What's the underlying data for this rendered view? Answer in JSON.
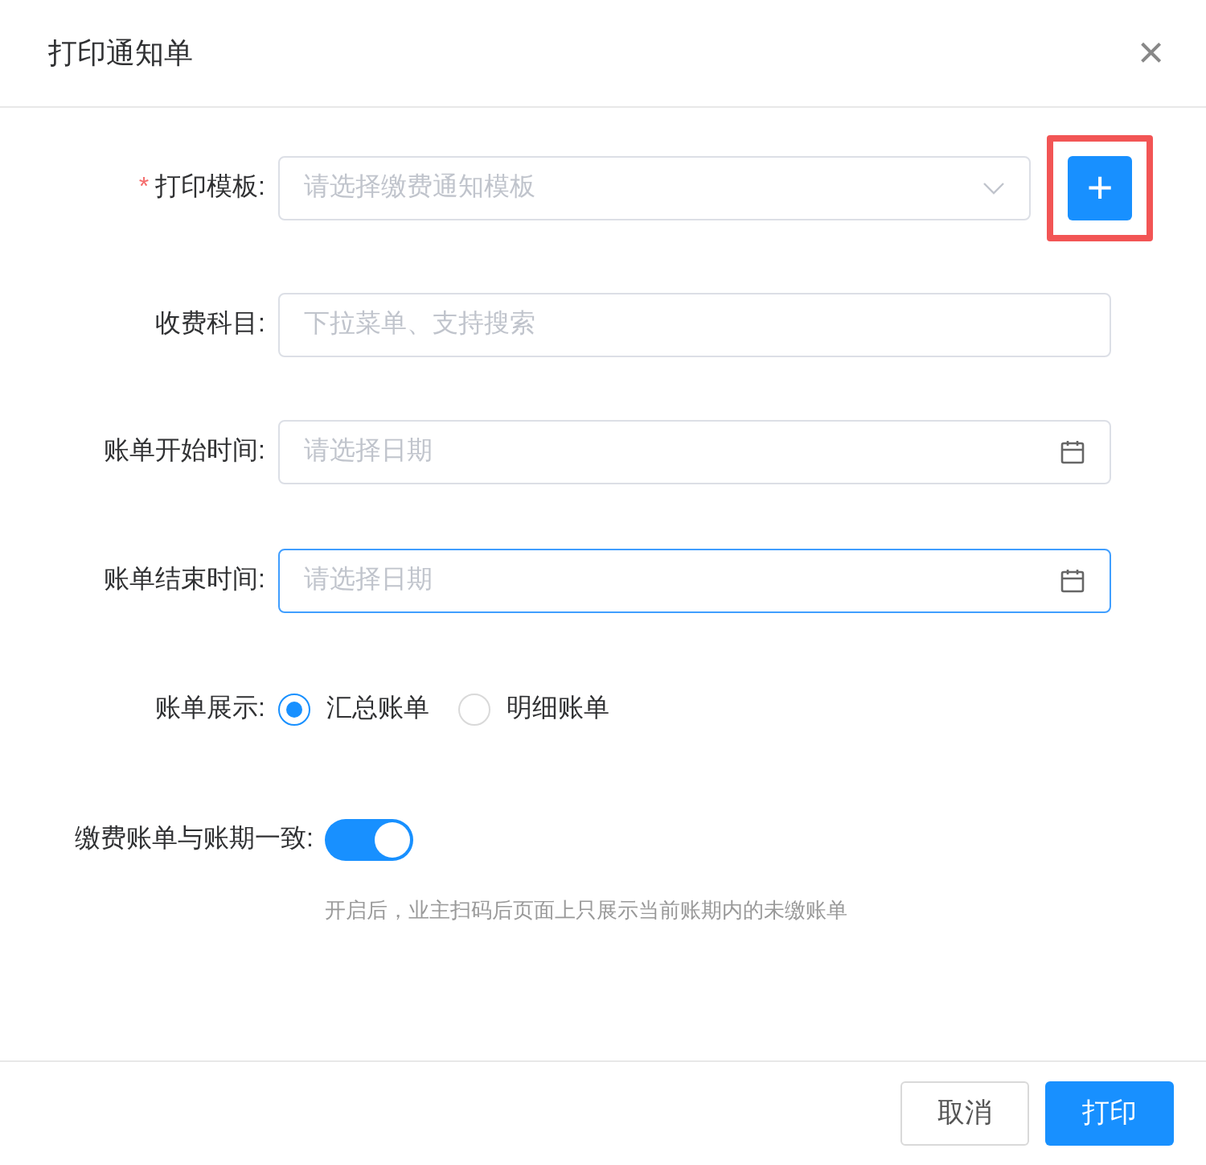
{
  "dialog": {
    "title": "打印通知单",
    "close": "×"
  },
  "fields": [
    {
      "kind": "select",
      "label": "打印模板:",
      "required_mark": "*",
      "placeholder": "请选择缴费通知模板",
      "focused": false,
      "add_button": {
        "label": "+",
        "highlighted": true
      }
    },
    {
      "kind": "input",
      "label": "收费科目:",
      "placeholder": "下拉菜单、支持搜索",
      "focused": false
    },
    {
      "kind": "date",
      "label": "账单开始时间:",
      "placeholder": "请选择日期",
      "focused": false
    },
    {
      "kind": "date",
      "label": "账单结束时间:",
      "placeholder": "请选择日期",
      "focused": true
    }
  ],
  "bill_display": {
    "label": "账单展示:",
    "options": [
      {
        "label": "汇总账单",
        "selected": true
      },
      {
        "label": "明细账单",
        "selected": false
      }
    ]
  },
  "sync_period": {
    "label": "缴费账单与账期一致:",
    "on": true,
    "hint": "开启后，业主扫码后页面上只展示当前账期内的未缴账单"
  },
  "buttons": [
    {
      "label": "取消",
      "kind": "secondary"
    },
    {
      "label": "打印",
      "kind": "primary"
    }
  ]
}
